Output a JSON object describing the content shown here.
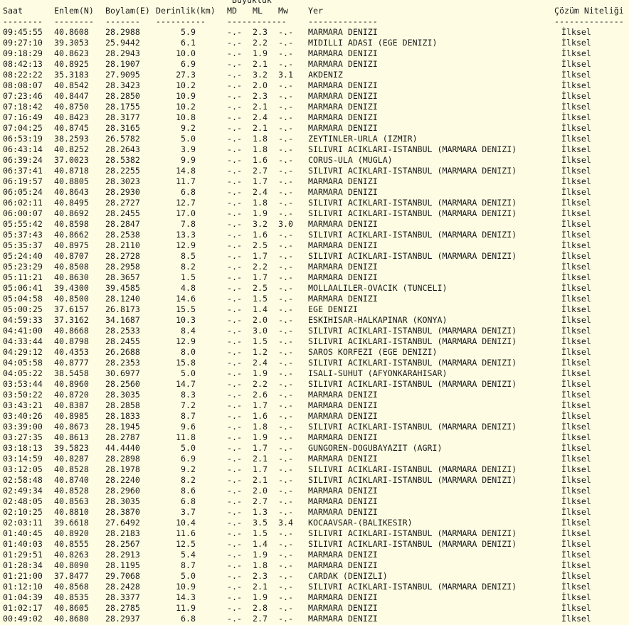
{
  "header": {
    "magnitude_group": "Buyukluk",
    "saat": "Saat",
    "enlem": "Enlem(N)",
    "boylam": "Boylam(E)",
    "derinlik": "Derinlik(km)",
    "md": "MD",
    "ml": "ML",
    "mw": "Mw",
    "yer": "Yer",
    "cozum": "Çözüm Niteliği"
  },
  "separators": {
    "saat": "--------",
    "enlem": "--------",
    "boylam": "-------",
    "derinlik": "----------",
    "magnitude": "------------",
    "yer": "--------------",
    "cozum": "--------------"
  },
  "rows": [
    {
      "saat": "09:45:55",
      "enlem": "40.8608",
      "boylam": "28.2988",
      "derinlik": "5.9",
      "md": "-.-",
      "ml": "2.3",
      "mw": "-.-",
      "yer": "MARMARA DENIZI",
      "cozum": "İlksel"
    },
    {
      "saat": "09:27:10",
      "enlem": "39.3053",
      "boylam": "25.9442",
      "derinlik": "6.1",
      "md": "-.-",
      "ml": "2.2",
      "mw": "-.-",
      "yer": "MIDILLI ADASI (EGE DENIZI)",
      "cozum": "İlksel"
    },
    {
      "saat": "09:18:29",
      "enlem": "40.8623",
      "boylam": "28.2943",
      "derinlik": "10.0",
      "md": "-.-",
      "ml": "1.9",
      "mw": "-.-",
      "yer": "MARMARA DENIZI",
      "cozum": "İlksel"
    },
    {
      "saat": "08:42:13",
      "enlem": "40.8925",
      "boylam": "28.1907",
      "derinlik": "6.9",
      "md": "-.-",
      "ml": "2.1",
      "mw": "-.-",
      "yer": "MARMARA DENIZI",
      "cozum": "İlksel"
    },
    {
      "saat": "08:22:22",
      "enlem": "35.3183",
      "boylam": "27.9095",
      "derinlik": "27.3",
      "md": "-.-",
      "ml": "3.2",
      "mw": "3.1",
      "yer": "AKDENIZ",
      "cozum": "İlksel"
    },
    {
      "saat": "08:08:07",
      "enlem": "40.8542",
      "boylam": "28.3423",
      "derinlik": "10.2",
      "md": "-.-",
      "ml": "2.0",
      "mw": "-.-",
      "yer": "MARMARA DENIZI",
      "cozum": "İlksel"
    },
    {
      "saat": "07:23:46",
      "enlem": "40.8447",
      "boylam": "28.2850",
      "derinlik": "10.9",
      "md": "-.-",
      "ml": "2.3",
      "mw": "-.-",
      "yer": "MARMARA DENIZI",
      "cozum": "İlksel"
    },
    {
      "saat": "07:18:42",
      "enlem": "40.8750",
      "boylam": "28.1755",
      "derinlik": "10.2",
      "md": "-.-",
      "ml": "2.1",
      "mw": "-.-",
      "yer": "MARMARA DENIZI",
      "cozum": "İlksel"
    },
    {
      "saat": "07:16:49",
      "enlem": "40.8423",
      "boylam": "28.3177",
      "derinlik": "10.8",
      "md": "-.-",
      "ml": "2.4",
      "mw": "-.-",
      "yer": "MARMARA DENIZI",
      "cozum": "İlksel"
    },
    {
      "saat": "07:04:25",
      "enlem": "40.8745",
      "boylam": "28.3165",
      "derinlik": "9.2",
      "md": "-.-",
      "ml": "2.1",
      "mw": "-.-",
      "yer": "MARMARA DENIZI",
      "cozum": "İlksel"
    },
    {
      "saat": "06:53:19",
      "enlem": "38.2593",
      "boylam": "26.5782",
      "derinlik": "5.0",
      "md": "-.-",
      "ml": "1.8",
      "mw": "-.-",
      "yer": "ZEYTINLER-URLA (IZMIR)",
      "cozum": "İlksel"
    },
    {
      "saat": "06:43:14",
      "enlem": "40.8252",
      "boylam": "28.2643",
      "derinlik": "3.9",
      "md": "-.-",
      "ml": "1.8",
      "mw": "-.-",
      "yer": "SILIVRI ACIKLARI-ISTANBUL (MARMARA DENIZI)",
      "cozum": "İlksel"
    },
    {
      "saat": "06:39:24",
      "enlem": "37.0023",
      "boylam": "28.5382",
      "derinlik": "9.9",
      "md": "-.-",
      "ml": "1.6",
      "mw": "-.-",
      "yer": "CORUS-ULA (MUGLA)",
      "cozum": "İlksel"
    },
    {
      "saat": "06:37:41",
      "enlem": "40.8718",
      "boylam": "28.2255",
      "derinlik": "14.8",
      "md": "-.-",
      "ml": "2.7",
      "mw": "-.-",
      "yer": "SILIVRI ACIKLARI-ISTANBUL (MARMARA DENIZI)",
      "cozum": "İlksel"
    },
    {
      "saat": "06:19:57",
      "enlem": "40.8805",
      "boylam": "28.3023",
      "derinlik": "11.7",
      "md": "-.-",
      "ml": "1.7",
      "mw": "-.-",
      "yer": "MARMARA DENIZI",
      "cozum": "İlksel"
    },
    {
      "saat": "06:05:24",
      "enlem": "40.8643",
      "boylam": "28.2930",
      "derinlik": "6.8",
      "md": "-.-",
      "ml": "2.4",
      "mw": "-.-",
      "yer": "MARMARA DENIZI",
      "cozum": "İlksel"
    },
    {
      "saat": "06:02:11",
      "enlem": "40.8495",
      "boylam": "28.2727",
      "derinlik": "12.7",
      "md": "-.-",
      "ml": "1.8",
      "mw": "-.-",
      "yer": "SILIVRI ACIKLARI-ISTANBUL (MARMARA DENIZI)",
      "cozum": "İlksel"
    },
    {
      "saat": "06:00:07",
      "enlem": "40.8692",
      "boylam": "28.2455",
      "derinlik": "17.0",
      "md": "-.-",
      "ml": "1.9",
      "mw": "-.-",
      "yer": "SILIVRI ACIKLARI-ISTANBUL (MARMARA DENIZI)",
      "cozum": "İlksel"
    },
    {
      "saat": "05:55:42",
      "enlem": "40.8598",
      "boylam": "28.2847",
      "derinlik": "7.8",
      "md": "-.-",
      "ml": "3.2",
      "mw": "3.0",
      "yer": "MARMARA DENIZI",
      "cozum": "İlksel"
    },
    {
      "saat": "05:37:43",
      "enlem": "40.8662",
      "boylam": "28.2538",
      "derinlik": "13.3",
      "md": "-.-",
      "ml": "1.6",
      "mw": "-.-",
      "yer": "SILIVRI ACIKLARI-ISTANBUL (MARMARA DENIZI)",
      "cozum": "İlksel"
    },
    {
      "saat": "05:35:37",
      "enlem": "40.8975",
      "boylam": "28.2110",
      "derinlik": "12.9",
      "md": "-.-",
      "ml": "2.5",
      "mw": "-.-",
      "yer": "MARMARA DENIZI",
      "cozum": "İlksel"
    },
    {
      "saat": "05:24:40",
      "enlem": "40.8707",
      "boylam": "28.2728",
      "derinlik": "8.5",
      "md": "-.-",
      "ml": "1.7",
      "mw": "-.-",
      "yer": "SILIVRI ACIKLARI-ISTANBUL (MARMARA DENIZI)",
      "cozum": "İlksel"
    },
    {
      "saat": "05:23:29",
      "enlem": "40.8508",
      "boylam": "28.2958",
      "derinlik": "8.2",
      "md": "-.-",
      "ml": "2.2",
      "mw": "-.-",
      "yer": "MARMARA DENIZI",
      "cozum": "İlksel"
    },
    {
      "saat": "05:11:21",
      "enlem": "40.8630",
      "boylam": "28.3657",
      "derinlik": "1.5",
      "md": "-.-",
      "ml": "1.7",
      "mw": "-.-",
      "yer": "MARMARA DENIZI",
      "cozum": "İlksel"
    },
    {
      "saat": "05:06:41",
      "enlem": "39.4300",
      "boylam": "39.4585",
      "derinlik": "4.8",
      "md": "-.-",
      "ml": "2.5",
      "mw": "-.-",
      "yer": "MOLLAALILER-OVACIK (TUNCELI)",
      "cozum": "İlksel"
    },
    {
      "saat": "05:04:58",
      "enlem": "40.8500",
      "boylam": "28.1240",
      "derinlik": "14.6",
      "md": "-.-",
      "ml": "1.5",
      "mw": "-.-",
      "yer": "MARMARA DENIZI",
      "cozum": "İlksel"
    },
    {
      "saat": "05:00:25",
      "enlem": "37.6157",
      "boylam": "26.8173",
      "derinlik": "15.5",
      "md": "-.-",
      "ml": "1.4",
      "mw": "-.-",
      "yer": "EGE DENIZI",
      "cozum": "İlksel"
    },
    {
      "saat": "04:59:33",
      "enlem": "37.3162",
      "boylam": "34.1687",
      "derinlik": "10.3",
      "md": "-.-",
      "ml": "2.0",
      "mw": "-.-",
      "yer": "ESKIHISAR-HALKAPINAR (KONYA)",
      "cozum": "İlksel"
    },
    {
      "saat": "04:41:00",
      "enlem": "40.8668",
      "boylam": "28.2533",
      "derinlik": "8.4",
      "md": "-.-",
      "ml": "3.0",
      "mw": "-.-",
      "yer": "SILIVRI ACIKLARI-ISTANBUL (MARMARA DENIZI)",
      "cozum": "İlksel"
    },
    {
      "saat": "04:33:44",
      "enlem": "40.8798",
      "boylam": "28.2455",
      "derinlik": "12.9",
      "md": "-.-",
      "ml": "1.5",
      "mw": "-.-",
      "yer": "SILIVRI ACIKLARI-ISTANBUL (MARMARA DENIZI)",
      "cozum": "İlksel"
    },
    {
      "saat": "04:29:12",
      "enlem": "40.4353",
      "boylam": "26.2688",
      "derinlik": "8.0",
      "md": "-.-",
      "ml": "1.2",
      "mw": "-.-",
      "yer": "SAROS KORFEZI (EGE DENIZI)",
      "cozum": "İlksel"
    },
    {
      "saat": "04:05:58",
      "enlem": "40.8777",
      "boylam": "28.2353",
      "derinlik": "15.8",
      "md": "-.-",
      "ml": "2.4",
      "mw": "-.-",
      "yer": "SILIVRI ACIKLARI-ISTANBUL (MARMARA DENIZI)",
      "cozum": "İlksel"
    },
    {
      "saat": "04:05:22",
      "enlem": "38.5458",
      "boylam": "30.6977",
      "derinlik": "5.0",
      "md": "-.-",
      "ml": "1.9",
      "mw": "-.-",
      "yer": "ISALI-SUHUT (AFYONKARAHISAR)",
      "cozum": "İlksel"
    },
    {
      "saat": "03:53:44",
      "enlem": "40.8960",
      "boylam": "28.2560",
      "derinlik": "14.7",
      "md": "-.-",
      "ml": "2.2",
      "mw": "-.-",
      "yer": "SILIVRI ACIKLARI-ISTANBUL (MARMARA DENIZI)",
      "cozum": "İlksel"
    },
    {
      "saat": "03:50:22",
      "enlem": "40.8720",
      "boylam": "28.3035",
      "derinlik": "8.3",
      "md": "-.-",
      "ml": "2.6",
      "mw": "-.-",
      "yer": "MARMARA DENIZI",
      "cozum": "İlksel"
    },
    {
      "saat": "03:43:21",
      "enlem": "40.8387",
      "boylam": "28.2858",
      "derinlik": "7.2",
      "md": "-.-",
      "ml": "1.7",
      "mw": "-.-",
      "yer": "MARMARA DENIZI",
      "cozum": "İlksel"
    },
    {
      "saat": "03:40:26",
      "enlem": "40.8985",
      "boylam": "28.1833",
      "derinlik": "8.7",
      "md": "-.-",
      "ml": "1.6",
      "mw": "-.-",
      "yer": "MARMARA DENIZI",
      "cozum": "İlksel"
    },
    {
      "saat": "03:39:00",
      "enlem": "40.8673",
      "boylam": "28.1945",
      "derinlik": "9.6",
      "md": "-.-",
      "ml": "1.8",
      "mw": "-.-",
      "yer": "SILIVRI ACIKLARI-ISTANBUL (MARMARA DENIZI)",
      "cozum": "İlksel"
    },
    {
      "saat": "03:27:35",
      "enlem": "40.8613",
      "boylam": "28.2787",
      "derinlik": "11.8",
      "md": "-.-",
      "ml": "1.9",
      "mw": "-.-",
      "yer": "MARMARA DENIZI",
      "cozum": "İlksel"
    },
    {
      "saat": "03:18:13",
      "enlem": "39.5823",
      "boylam": "44.4440",
      "derinlik": "5.0",
      "md": "-.-",
      "ml": "1.7",
      "mw": "-.-",
      "yer": "GUNGOREN-DOGUBAYAZIT (AGRI)",
      "cozum": "İlksel"
    },
    {
      "saat": "03:14:59",
      "enlem": "40.8287",
      "boylam": "28.2898",
      "derinlik": "6.9",
      "md": "-.-",
      "ml": "2.1",
      "mw": "-.-",
      "yer": "MARMARA DENIZI",
      "cozum": "İlksel"
    },
    {
      "saat": "03:12:05",
      "enlem": "40.8528",
      "boylam": "28.1978",
      "derinlik": "9.2",
      "md": "-.-",
      "ml": "1.7",
      "mw": "-.-",
      "yer": "SILIVRI ACIKLARI-ISTANBUL (MARMARA DENIZI)",
      "cozum": "İlksel"
    },
    {
      "saat": "02:58:48",
      "enlem": "40.8740",
      "boylam": "28.2240",
      "derinlik": "8.2",
      "md": "-.-",
      "ml": "2.1",
      "mw": "-.-",
      "yer": "SILIVRI ACIKLARI-ISTANBUL (MARMARA DENIZI)",
      "cozum": "İlksel"
    },
    {
      "saat": "02:49:34",
      "enlem": "40.8528",
      "boylam": "28.2960",
      "derinlik": "8.6",
      "md": "-.-",
      "ml": "2.0",
      "mw": "-.-",
      "yer": "MARMARA DENIZI",
      "cozum": "İlksel"
    },
    {
      "saat": "02:48:05",
      "enlem": "40.8563",
      "boylam": "28.3035",
      "derinlik": "6.8",
      "md": "-.-",
      "ml": "2.7",
      "mw": "-.-",
      "yer": "MARMARA DENIZI",
      "cozum": "İlksel"
    },
    {
      "saat": "02:10:25",
      "enlem": "40.8810",
      "boylam": "28.3870",
      "derinlik": "3.7",
      "md": "-.-",
      "ml": "1.3",
      "mw": "-.-",
      "yer": "MARMARA DENIZI",
      "cozum": "İlksel"
    },
    {
      "saat": "02:03:11",
      "enlem": "39.6618",
      "boylam": "27.6492",
      "derinlik": "10.4",
      "md": "-.-",
      "ml": "3.5",
      "mw": "3.4",
      "yer": "KOCAAVSAR-(BALIKESIR)",
      "cozum": "İlksel"
    },
    {
      "saat": "01:40:45",
      "enlem": "40.8920",
      "boylam": "28.2183",
      "derinlik": "11.6",
      "md": "-.-",
      "ml": "1.5",
      "mw": "-.-",
      "yer": "SILIVRI ACIKLARI-ISTANBUL (MARMARA DENIZI)",
      "cozum": "İlksel"
    },
    {
      "saat": "01:40:03",
      "enlem": "40.8555",
      "boylam": "28.2567",
      "derinlik": "12.5",
      "md": "-.-",
      "ml": "1.4",
      "mw": "-.-",
      "yer": "SILIVRI ACIKLARI-ISTANBUL (MARMARA DENIZI)",
      "cozum": "İlksel"
    },
    {
      "saat": "01:29:51",
      "enlem": "40.8263",
      "boylam": "28.2913",
      "derinlik": "5.4",
      "md": "-.-",
      "ml": "1.9",
      "mw": "-.-",
      "yer": "MARMARA DENIZI",
      "cozum": "İlksel"
    },
    {
      "saat": "01:28:34",
      "enlem": "40.8090",
      "boylam": "28.1195",
      "derinlik": "8.7",
      "md": "-.-",
      "ml": "1.8",
      "mw": "-.-",
      "yer": "MARMARA DENIZI",
      "cozum": "İlksel"
    },
    {
      "saat": "01:21:00",
      "enlem": "37.8477",
      "boylam": "29.7068",
      "derinlik": "5.0",
      "md": "-.-",
      "ml": "2.3",
      "mw": "-.-",
      "yer": "CARDAK (DENIZLI)",
      "cozum": "İlksel"
    },
    {
      "saat": "01:12:10",
      "enlem": "40.8568",
      "boylam": "28.2428",
      "derinlik": "10.9",
      "md": "-.-",
      "ml": "2.1",
      "mw": "-.-",
      "yer": "SILIVRI ACIKLARI-ISTANBUL (MARMARA DENIZI)",
      "cozum": "İlksel"
    },
    {
      "saat": "01:04:39",
      "enlem": "40.8535",
      "boylam": "28.3377",
      "derinlik": "14.3",
      "md": "-.-",
      "ml": "1.9",
      "mw": "-.-",
      "yer": "MARMARA DENIZI",
      "cozum": "İlksel"
    },
    {
      "saat": "01:02:17",
      "enlem": "40.8605",
      "boylam": "28.2785",
      "derinlik": "11.9",
      "md": "-.-",
      "ml": "2.8",
      "mw": "-.-",
      "yer": "MARMARA DENIZI",
      "cozum": "İlksel"
    },
    {
      "saat": "00:49:02",
      "enlem": "40.8680",
      "boylam": "28.2937",
      "derinlik": "6.8",
      "md": "-.-",
      "ml": "2.7",
      "mw": "-.-",
      "yer": "MARMARA DENIZI",
      "cozum": "İlksel"
    }
  ]
}
